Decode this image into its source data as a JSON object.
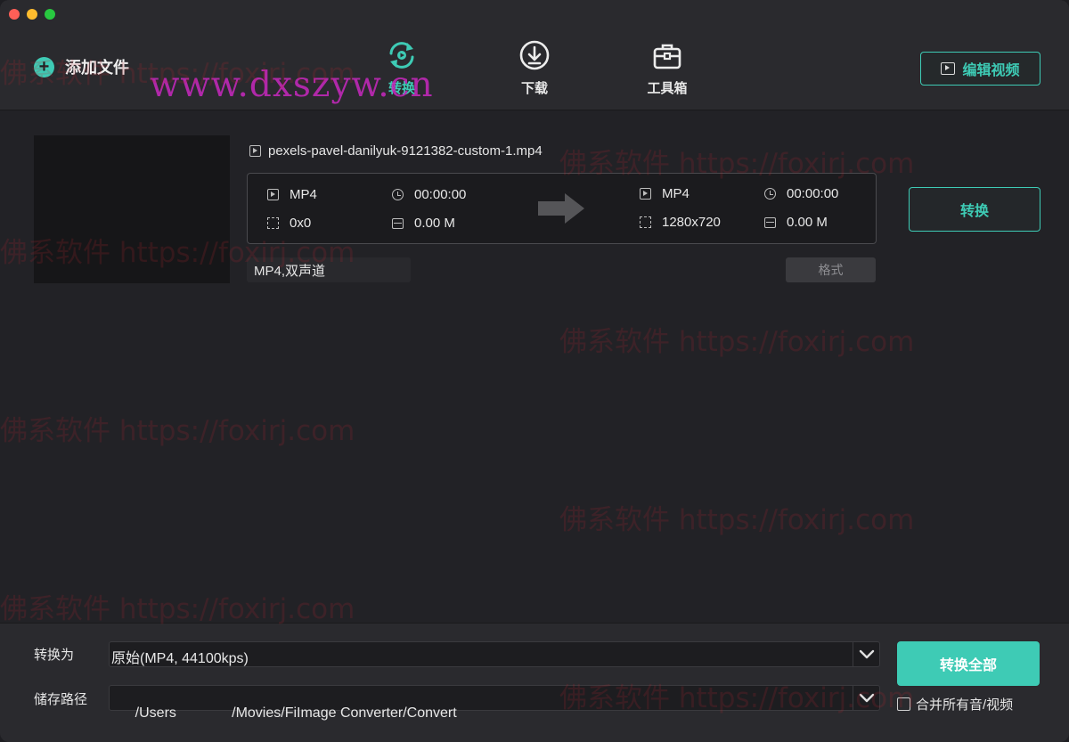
{
  "toolbar": {
    "add_file_label": "添加文件",
    "tabs": [
      {
        "label": "转换",
        "icon": "convert-refresh-icon",
        "active": true
      },
      {
        "label": "下载",
        "icon": "download-icon",
        "active": false
      },
      {
        "label": "工具箱",
        "icon": "toolbox-icon",
        "active": false
      }
    ],
    "edit_video_label": "编辑视频"
  },
  "file": {
    "name": "pexels-pavel-danilyuk-9121382-custom-1.mp4",
    "source": {
      "format": "MP4",
      "duration": "00:00:00",
      "resolution": "0x0",
      "size": "0.00 M"
    },
    "target": {
      "format": "MP4",
      "duration": "00:00:00",
      "resolution": "1280x720",
      "size": "0.00 M"
    },
    "audio": "MP4,双声道",
    "format_button": "格式",
    "convert_button": "转换"
  },
  "bottom": {
    "convert_to_label": "转换为",
    "convert_to_value": "原始(MP4, 44100kps)",
    "save_path_label": "储存路径",
    "save_path_value": "/Users              /Movies/FiImage Converter/Convert",
    "convert_all_button": "转换全部",
    "merge_label": "合并所有音/视频"
  },
  "watermarks": {
    "url": "www.dxszyw.cn",
    "text": "佛系软件 https://foxirj.com"
  },
  "colors": {
    "accent": "#3ecbb5",
    "background": "#222226",
    "toolbar": "#2a2a2e"
  }
}
